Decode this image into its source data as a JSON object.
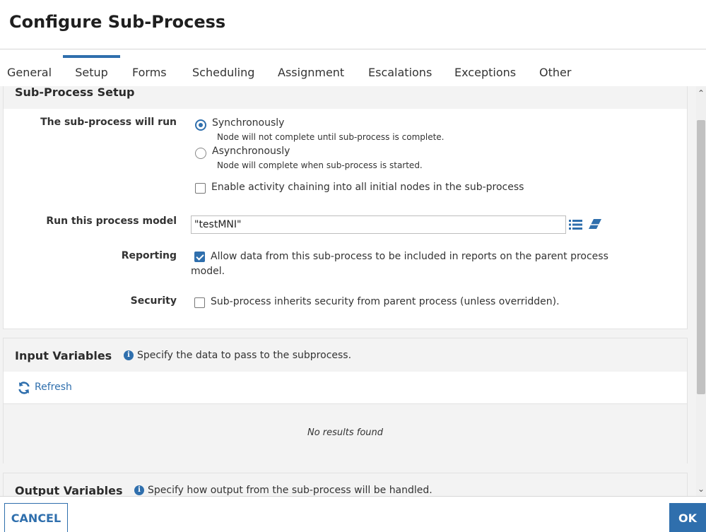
{
  "dialog": {
    "title": "Configure Sub-Process"
  },
  "tabs": [
    {
      "label": "General"
    },
    {
      "label": "Setup"
    },
    {
      "label": "Forms"
    },
    {
      "label": "Scheduling"
    },
    {
      "label": "Assignment"
    },
    {
      "label": "Escalations"
    },
    {
      "label": "Exceptions"
    },
    {
      "label": "Other"
    }
  ],
  "active_tab": "Setup",
  "setup": {
    "title": "Sub-Process Setup",
    "run_mode": {
      "label": "The sub-process will run",
      "selected": "Synchronously",
      "options": [
        {
          "label": "Synchronously",
          "help": "Node will not complete until sub-process is complete."
        },
        {
          "label": "Asynchronously",
          "help": "Node will complete when sub-process is started."
        }
      ],
      "chaining": {
        "label": "Enable activity chaining into all initial nodes in the sub-process",
        "checked": false
      }
    },
    "process_model": {
      "label": "Run this process model",
      "value": "\"testMNI\""
    },
    "reporting": {
      "label": "Reporting",
      "text_line1": "Allow data from this sub-process to be included in reports on the parent process",
      "text_line2": "model.",
      "checked": true
    },
    "security": {
      "label": "Security",
      "text": "Sub-process inherits security from parent process (unless overridden).",
      "checked": false
    }
  },
  "input_variables": {
    "title": "Input Variables",
    "info": "Specify the data to pass to the subprocess.",
    "refresh_label": "Refresh",
    "empty_text": "No results found"
  },
  "output_variables": {
    "title": "Output Variables",
    "info": "Specify how output from the sub-process will be handled."
  },
  "footer": {
    "cancel_label": "CANCEL",
    "ok_label": "OK"
  },
  "colors": {
    "accent": "#2f6fad",
    "panel_bg": "#f3f3f3"
  }
}
